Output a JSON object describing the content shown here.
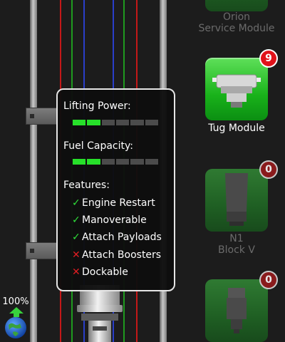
{
  "modules": [
    {
      "name_line1": "Orion",
      "name_line2": "Service Module",
      "count": null,
      "state": "dim"
    },
    {
      "name_line1": "Tug Module",
      "name_line2": "",
      "count": "9",
      "state": "active"
    },
    {
      "name_line1": "N1",
      "name_line2": "Block V",
      "count": "0",
      "state": "dim"
    },
    {
      "name_line1": "",
      "name_line2": "",
      "count": "0",
      "state": "dim"
    }
  ],
  "info": {
    "lifting_power_label": "Lifting Power:",
    "lifting_power_level": 0.33,
    "fuel_capacity_label": "Fuel Capacity:",
    "fuel_capacity_level": 0.33,
    "features_label": "Features:",
    "features": [
      {
        "label": "Engine Restart",
        "enabled": true
      },
      {
        "label": "Manoverable",
        "enabled": true
      },
      {
        "label": "Attach Payloads",
        "enabled": true
      },
      {
        "label": "Attach Boosters",
        "enabled": false
      },
      {
        "label": "Dockable",
        "enabled": false
      }
    ]
  },
  "zoom": {
    "value": "100%"
  },
  "icons": {
    "check": "check-icon",
    "cross": "cross-icon",
    "globe": "globe-icon",
    "zoom_up": "arrow-up-icon"
  },
  "colors": {
    "accent_green": "#27e02a",
    "badge_red": "#e0121a",
    "guide_red": "#d11a1a",
    "guide_green": "#1ea01e",
    "guide_blue": "#2a3fc9"
  }
}
